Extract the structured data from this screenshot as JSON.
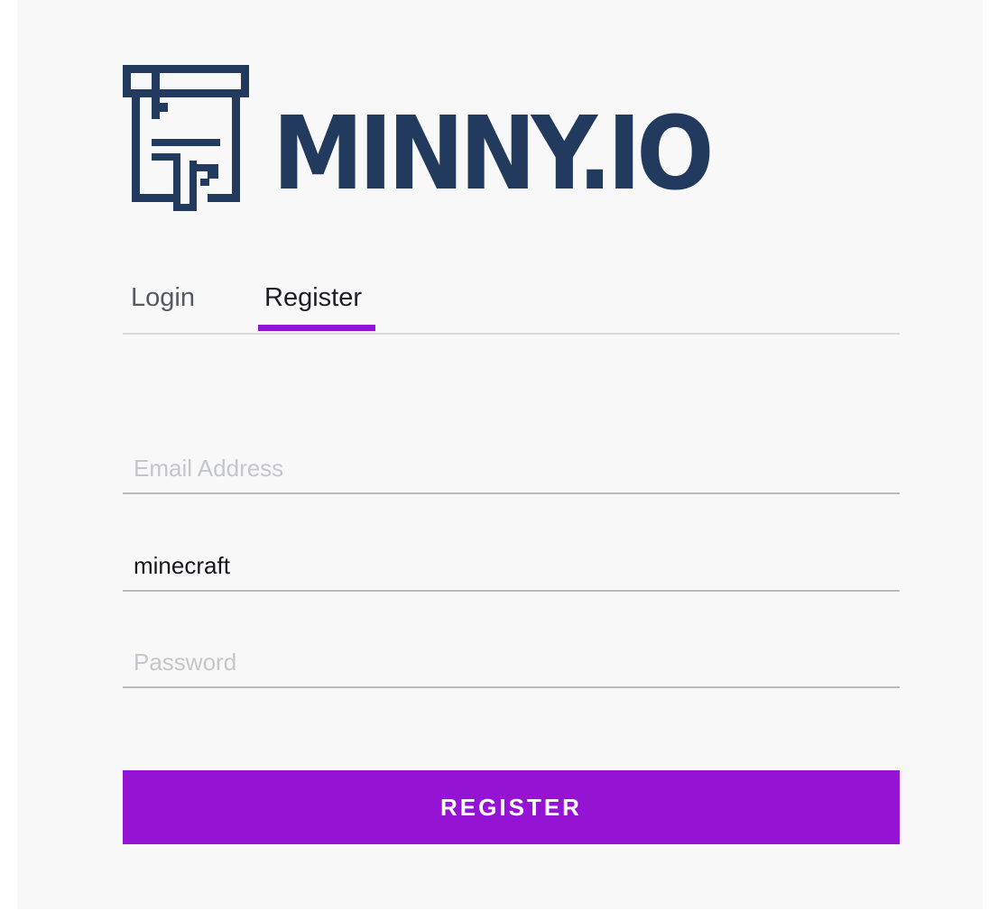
{
  "logo": {
    "text": "MINNY.IO",
    "icon": "printer-box-icon",
    "color": "#213a5e"
  },
  "tabs": [
    {
      "label": "Login",
      "active": false
    },
    {
      "label": "Register",
      "active": true
    }
  ],
  "form": {
    "email": {
      "value": "",
      "placeholder": "Email Address"
    },
    "username": {
      "value": "minecraft",
      "placeholder": ""
    },
    "password": {
      "value": "",
      "placeholder": "Password"
    },
    "submit_label": "REGISTER"
  },
  "colors": {
    "accent": "#9514d4",
    "background": "#f8f8f9",
    "logo": "#213a5e"
  }
}
